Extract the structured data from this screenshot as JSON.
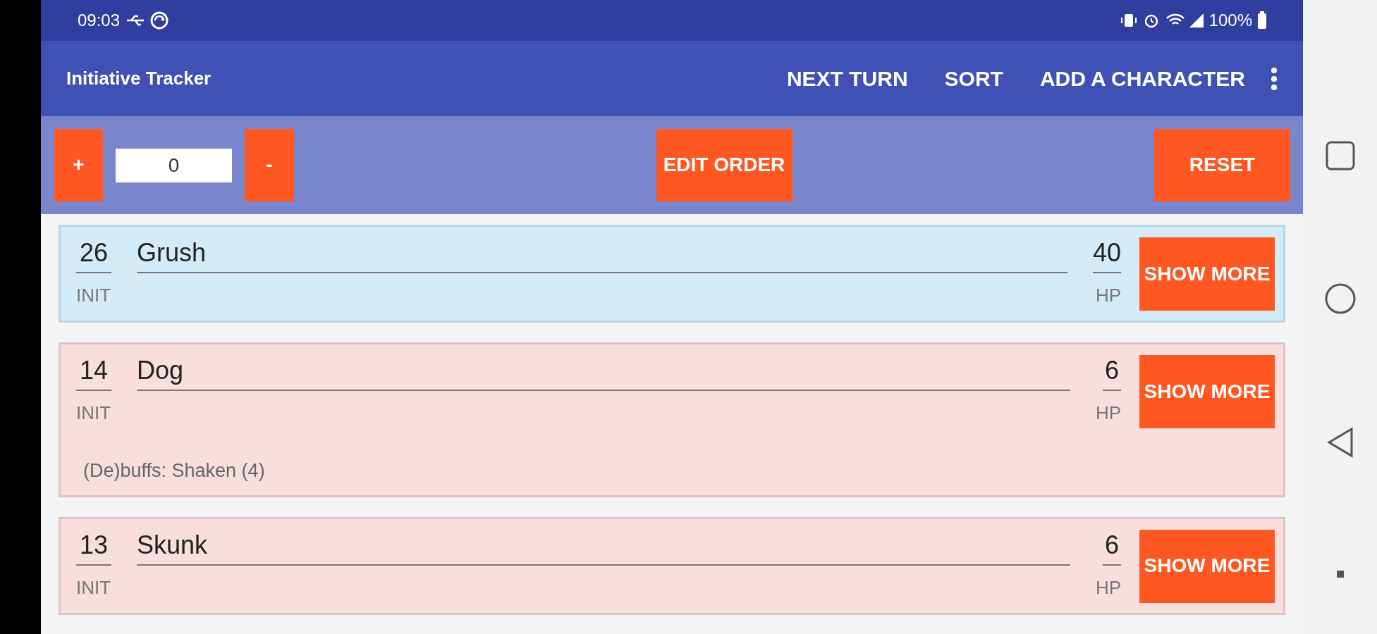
{
  "status_bar": {
    "time": "09:03",
    "battery": "100%"
  },
  "toolbar": {
    "title": "Initiative Tracker",
    "actions": [
      "NEXT TURN",
      "SORT",
      "ADD A CHARACTER"
    ]
  },
  "controls": {
    "plus": "+",
    "value": "0",
    "minus": "-",
    "edit": "EDIT ORDER",
    "reset": "RESET"
  },
  "characters": [
    {
      "init": "26",
      "init_label": "INIT",
      "name": "Grush",
      "hp": "40",
      "hp_label": "HP",
      "button": "SHOW MORE",
      "current": true
    },
    {
      "init": "14",
      "init_label": "INIT",
      "name": "Dog",
      "hp": "6",
      "hp_label": "HP",
      "button": "SHOW MORE",
      "current": false,
      "buffs": "(De)buffs: Shaken (4)"
    },
    {
      "init": "13",
      "init_label": "INIT",
      "name": "Skunk",
      "hp": "6",
      "hp_label": "HP",
      "button": "SHOW MORE",
      "current": false
    }
  ]
}
